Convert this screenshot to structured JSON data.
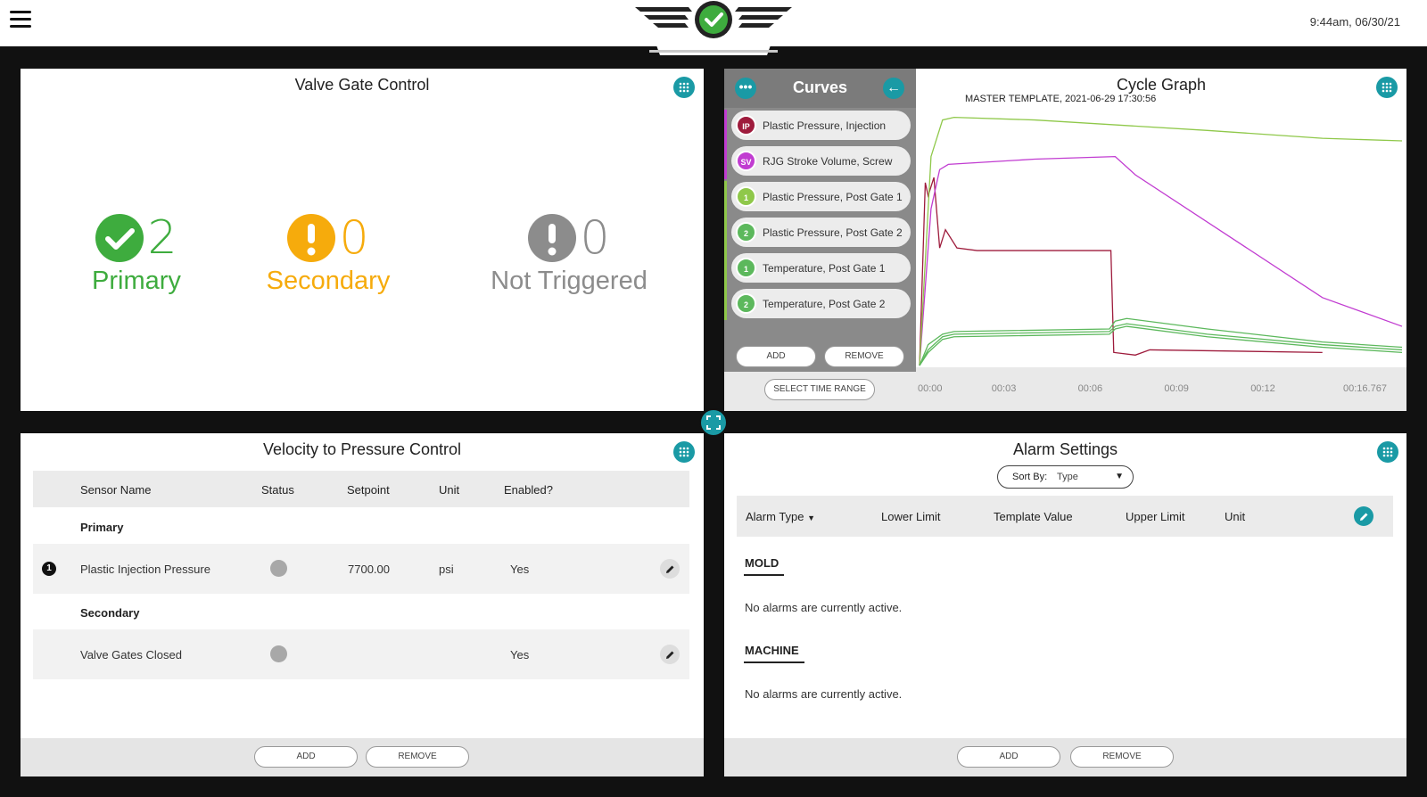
{
  "header": {
    "timestamp": "9:44am, 06/30/21"
  },
  "valve_gate": {
    "title": "Valve Gate Control",
    "items": [
      {
        "label": "Primary",
        "count": "2",
        "color": "#3eac3e"
      },
      {
        "label": "Secondary",
        "count": "0",
        "color": "#f6ab0c"
      },
      {
        "label": "Not Triggered",
        "count": "0",
        "color": "#8c8c8c"
      }
    ]
  },
  "curves": {
    "title": "Curves",
    "items": [
      {
        "badge": "IP",
        "label": "Plastic Pressure, Injection",
        "color": "#9e1b3c"
      },
      {
        "badge": "SV",
        "label": "RJG Stroke Volume, Screw",
        "color": "#c13cd1"
      },
      {
        "badge": "1",
        "label": "Plastic Pressure, Post Gate 1",
        "color": "#8fc84a"
      },
      {
        "badge": "2",
        "label": "Plastic Pressure, Post Gate 2",
        "color": "#5cb85c"
      },
      {
        "badge": "1",
        "label": "Temperature, Post Gate 1",
        "color": "#5cb85c"
      },
      {
        "badge": "2",
        "label": "Temperature, Post Gate 2",
        "color": "#5cb85c"
      }
    ],
    "add_label": "ADD",
    "remove_label": "REMOVE",
    "select_range_label": "SELECT TIME RANGE"
  },
  "cycle_graph": {
    "title": "Cycle Graph",
    "subtitle": "MASTER TEMPLATE, 2021-06-29   17:30:56",
    "ticks": [
      "00:00",
      "00:03",
      "00:06",
      "00:09",
      "00:12",
      "00:16.767"
    ]
  },
  "chart_data": {
    "type": "line",
    "title": "Cycle Graph",
    "x_ticks": [
      "00:00",
      "00:03",
      "00:06",
      "00:09",
      "00:12",
      "00:16.767"
    ],
    "xlim": [
      0,
      16.767
    ],
    "ylim": [
      0,
      100
    ],
    "grid": false,
    "series": [
      {
        "name": "Plastic Pressure, Injection",
        "color": "#9e1b3c",
        "x": [
          0.0,
          0.2,
          0.3,
          0.5,
          0.7,
          0.9,
          1.3,
          2,
          4,
          6.6,
          6.65,
          6.75,
          7.5,
          8,
          14
        ],
        "y": [
          0,
          70,
          65,
          72,
          45,
          52,
          45,
          44,
          44,
          44,
          44,
          5,
          4,
          6,
          5
        ]
      },
      {
        "name": "RJG Stroke Volume, Screw",
        "color": "#c13cd1",
        "x": [
          0.0,
          0.4,
          0.7,
          1.0,
          4,
          6.8,
          7.5,
          14,
          16.767
        ],
        "y": [
          0,
          60,
          75,
          77,
          79,
          80,
          73,
          26,
          15
        ]
      },
      {
        "name": "Plastic Pressure, Post Gate 1",
        "color": "#8fc84a",
        "x": [
          0.0,
          0.4,
          0.8,
          1.2,
          4,
          10,
          14,
          16.767
        ],
        "y": [
          0,
          80,
          94,
          95,
          94,
          90,
          87,
          86
        ]
      },
      {
        "name": "Plastic Pressure, Post Gate 2",
        "color": "#5cb85c",
        "x": [
          0.0,
          0.3,
          0.8,
          1.2,
          6.6,
          6.8,
          7.2,
          10,
          14,
          16.767
        ],
        "y": [
          0,
          8,
          12,
          13,
          14,
          17,
          18,
          14,
          9,
          7
        ]
      },
      {
        "name": "Temperature, Post Gate 1",
        "color": "#5cb85c",
        "x": [
          0.0,
          0.3,
          0.8,
          1.2,
          6.6,
          6.8,
          7.2,
          10,
          14,
          16.767
        ],
        "y": [
          0,
          6,
          11,
          12,
          13,
          15,
          16,
          12,
          8,
          6
        ]
      },
      {
        "name": "Temperature, Post Gate 2",
        "color": "#5cb85c",
        "x": [
          0.0,
          0.3,
          0.8,
          1.2,
          6.6,
          6.8,
          7.2,
          10,
          14,
          16.767
        ],
        "y": [
          0,
          5,
          10,
          11,
          12,
          14,
          15,
          11,
          7,
          5
        ]
      }
    ]
  },
  "vpc": {
    "title": "Velocity to Pressure Control",
    "columns": [
      "Sensor Name",
      "Status",
      "Setpoint",
      "Unit",
      "Enabled?"
    ],
    "primary_label": "Primary",
    "secondary_label": "Secondary",
    "rows": [
      {
        "num": "1",
        "name": "Plastic Injection Pressure",
        "setpoint": "7700.00",
        "unit": "psi",
        "enabled": "Yes"
      },
      {
        "name": "Valve Gates Closed",
        "setpoint": "",
        "unit": "",
        "enabled": "Yes"
      }
    ],
    "add_label": "ADD",
    "remove_label": "REMOVE"
  },
  "alarms": {
    "title": "Alarm Settings",
    "sort_label": "Sort By:",
    "sort_value": "Type",
    "columns": [
      "Alarm Type",
      "Lower Limit",
      "Template Value",
      "Upper Limit",
      "Unit"
    ],
    "categories": [
      {
        "name": "MOLD",
        "message": "No alarms are currently active."
      },
      {
        "name": "MACHINE",
        "message": "No alarms are currently active."
      }
    ],
    "add_label": "ADD",
    "remove_label": "REMOVE"
  }
}
